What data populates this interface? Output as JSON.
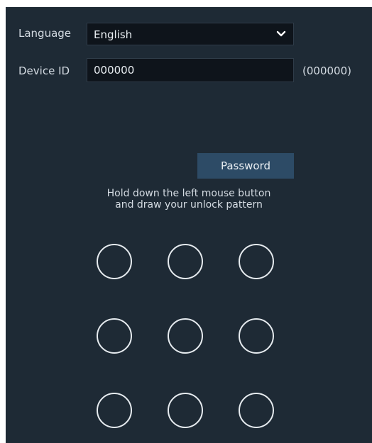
{
  "language": {
    "label": "Language",
    "value": "English",
    "icon": "chevron-down-icon"
  },
  "device_id": {
    "label": "Device ID",
    "value": "000000",
    "hint": "(000000)"
  },
  "password_button": {
    "label": "Password"
  },
  "instructions": {
    "line1": "Hold down the left mouse button",
    "line2": "and draw your unlock pattern"
  },
  "pattern": {
    "rows": 3,
    "cols": 3,
    "dots": [
      1,
      2,
      3,
      4,
      5,
      6,
      7,
      8,
      9
    ]
  },
  "colors": {
    "background": "#1e2a35",
    "field": "#0e141b",
    "button": "#2d4b66",
    "text": "#d4dbe2"
  }
}
